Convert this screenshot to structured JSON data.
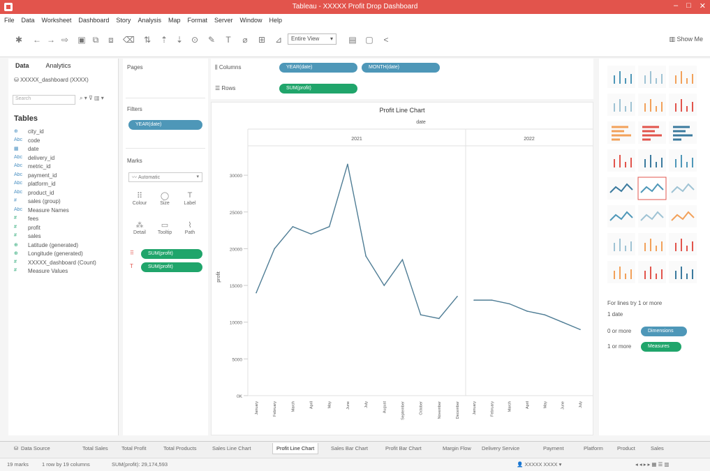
{
  "window": {
    "title": "Tableau - XXXXX Profit Drop Dashboard",
    "controls": [
      "–",
      "□",
      "✕"
    ]
  },
  "menu": [
    "File",
    "Data",
    "Worksheet",
    "Dashboard",
    "Story",
    "Analysis",
    "Map",
    "Format",
    "Server",
    "Window",
    "Help"
  ],
  "toolbar": {
    "view_dropdown": "Entire View",
    "show_me": "Show Me"
  },
  "data_pane": {
    "tabs": [
      "Data",
      "Analytics"
    ],
    "source": "XXXXX_dashboard (XXXX)",
    "search_placeholder": "Search",
    "tables_heading": "Tables",
    "fields": [
      {
        "type": "⊕",
        "name": "city_id",
        "kind": "dim"
      },
      {
        "type": "Abc",
        "name": "code",
        "kind": "dim"
      },
      {
        "type": "▦",
        "name": "date",
        "kind": "dim"
      },
      {
        "type": "Abc",
        "name": "delivery_id",
        "kind": "dim"
      },
      {
        "type": "Abc",
        "name": "metric_id",
        "kind": "dim"
      },
      {
        "type": "Abc",
        "name": "payment_id",
        "kind": "dim"
      },
      {
        "type": "Abc",
        "name": "platform_id",
        "kind": "dim"
      },
      {
        "type": "Abc",
        "name": "product_id",
        "kind": "dim"
      },
      {
        "type": "#",
        "name": "sales (group)",
        "kind": "dim"
      },
      {
        "type": "Abc",
        "name": "Measure Names",
        "kind": "dim"
      },
      {
        "type": "#",
        "name": "fees",
        "kind": "meas"
      },
      {
        "type": "#",
        "name": "profit",
        "kind": "meas"
      },
      {
        "type": "#",
        "name": "sales",
        "kind": "meas"
      },
      {
        "type": "⊕",
        "name": "Latitude (generated)",
        "kind": "meas"
      },
      {
        "type": "⊕",
        "name": "Longitude (generated)",
        "kind": "meas"
      },
      {
        "type": "#",
        "name": "XXXXX_dashboard (Count)",
        "kind": "meas"
      },
      {
        "type": "#",
        "name": "Measure Values",
        "kind": "meas"
      }
    ]
  },
  "cards": {
    "pages_label": "Pages",
    "filters_label": "Filters",
    "filter_pill": "YEAR(date)",
    "marks_label": "Marks",
    "marks_type": "Automatic",
    "mark_buttons": [
      {
        "glyph": "⠿",
        "label": "Colour"
      },
      {
        "glyph": "◯",
        "label": "Size"
      },
      {
        "glyph": "T",
        "label": "Label"
      },
      {
        "glyph": "⁂",
        "label": "Detail"
      },
      {
        "glyph": "▭",
        "label": "Tooltip"
      },
      {
        "glyph": "⌇",
        "label": "Path"
      }
    ],
    "mark_pills": [
      "SUM(profit)",
      "SUM(profit)"
    ]
  },
  "shelves": {
    "columns_label": "Columns",
    "rows_label": "Rows",
    "column_pills": [
      "YEAR(date)",
      "MONTH(date)"
    ],
    "row_pills": [
      "SUM(profit)"
    ]
  },
  "chart_data": {
    "type": "line",
    "title": "Profit Line Chart",
    "column_header": "date",
    "panels": [
      {
        "year": "2021",
        "x": [
          "January",
          "February",
          "March",
          "April",
          "May",
          "June",
          "July",
          "August",
          "September",
          "October",
          "November",
          "December"
        ],
        "values": [
          14000,
          20000,
          23000,
          22000,
          23000,
          31500,
          19000,
          15000,
          18500,
          11000,
          10500,
          13500
        ]
      },
      {
        "year": "2022",
        "x": [
          "January",
          "February",
          "March",
          "April",
          "May",
          "June",
          "July"
        ],
        "values": [
          13000,
          13000,
          12500,
          11500,
          11000,
          10000,
          9000
        ]
      }
    ],
    "ylabel": "profit",
    "yticks": [
      0,
      5000,
      10000,
      15000,
      20000,
      25000,
      30000
    ],
    "ytick_labels": [
      "0K",
      "5000",
      "10000",
      "15000",
      "20000",
      "25000",
      "30000"
    ],
    "ylim": [
      0,
      34000
    ],
    "colors": {
      "line": "#4f7d95"
    },
    "grid": false
  },
  "showme": {
    "note": "For lines try 1 or more",
    "dims_line": "1 date",
    "dims_label": "0 or more",
    "dims_pill": "Dimensions",
    "meas_label": "1 or more",
    "meas_pill": "Measures"
  },
  "sheet_tabs": [
    "Data Source",
    "Total Sales",
    "Total Profit",
    "Total Products",
    "Sales Line Chart",
    "Profit Line Chart",
    "Sales Bar Chart",
    "Profit Bar Chart",
    "Margin Flow",
    "Delivery Service",
    "Payment",
    "Platform",
    "Product",
    "Sales"
  ],
  "active_tab": "Profit Line Chart",
  "status": {
    "marks": "19 marks",
    "dims": "1 row by 19 columns",
    "sum": "SUM(profit): 29,174,593",
    "user": "XXXXX XXXX"
  }
}
